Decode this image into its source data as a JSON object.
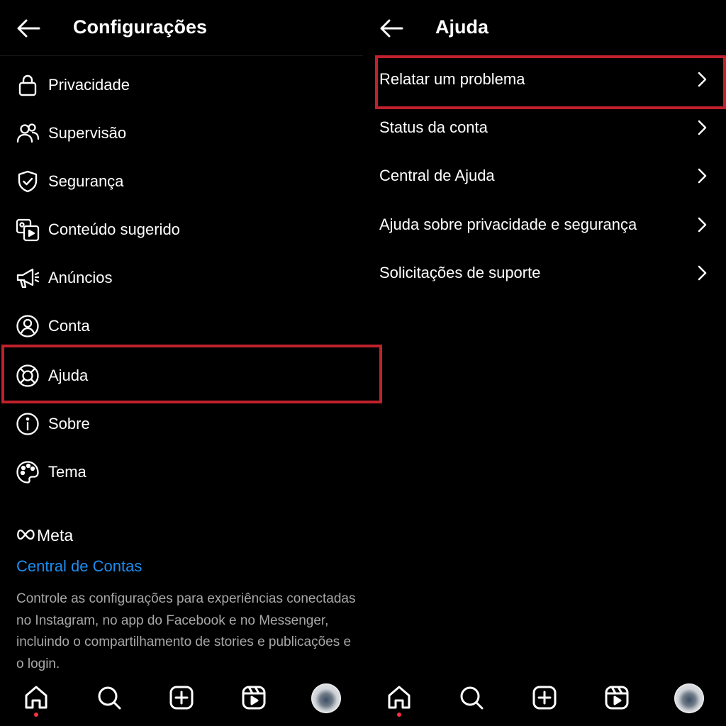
{
  "left_panel": {
    "title": "Configurações",
    "menu": [
      {
        "label": "Privacidade",
        "icon": "lock-icon"
      },
      {
        "label": "Supervisão",
        "icon": "people-icon"
      },
      {
        "label": "Segurança",
        "icon": "shield-check-icon"
      },
      {
        "label": "Conteúdo sugerido",
        "icon": "suggested-content-icon"
      },
      {
        "label": "Anúncios",
        "icon": "megaphone-icon"
      },
      {
        "label": "Conta",
        "icon": "account-circle-icon"
      },
      {
        "label": "Ajuda",
        "icon": "lifebuoy-icon"
      },
      {
        "label": "Sobre",
        "icon": "info-icon"
      },
      {
        "label": "Tema",
        "icon": "palette-icon"
      }
    ],
    "meta_wordmark": "Meta",
    "accounts_center_link": "Central de Contas",
    "accounts_center_description": "Controle as configurações para experiências conectadas no Instagram, no app do Facebook e no Messenger, incluindo o compartilhamento de stories e publicações e o login."
  },
  "right_panel": {
    "title": "Ajuda",
    "items": [
      {
        "label": "Relatar um problema"
      },
      {
        "label": "Status da conta"
      },
      {
        "label": "Central de Ajuda"
      },
      {
        "label": "Ajuda sobre privacidade e segurança"
      },
      {
        "label": "Solicitações de suporte"
      }
    ]
  },
  "bottom_nav": [
    "home-icon",
    "search-icon",
    "create-icon",
    "reels-icon",
    "profile-avatar"
  ],
  "colors": {
    "background": "#000000",
    "text": "#ffffff",
    "link": "#1d8ef1",
    "secondary_text": "#a8a8a8",
    "highlight_box": "#c0212c",
    "notification_dot": "#ff3040"
  }
}
